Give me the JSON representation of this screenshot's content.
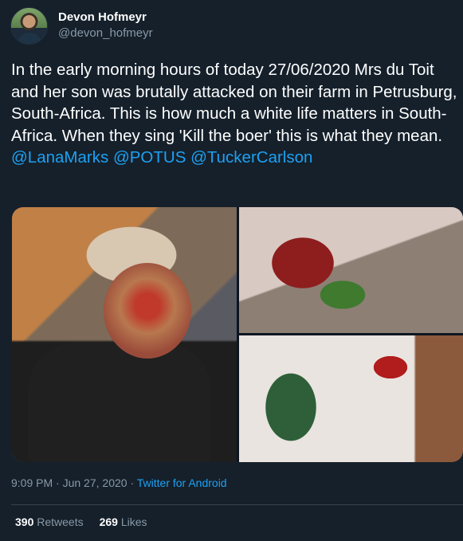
{
  "author": {
    "display_name": "Devon Hofmeyr",
    "handle": "@devon_hofmeyr"
  },
  "tweet": {
    "text_before": "In the early morning hours of today 27/06/2020 Mrs du Toit and her son was brutally attacked on their farm in Petrusburg, South-Africa. This is how much a white life matters in South-Africa. When they sing 'Kill the boer' this is what they mean. ",
    "mentions": [
      "@LanaMarks",
      "@POTUS",
      "@TuckerCarlson"
    ]
  },
  "meta": {
    "time": "9:09 PM",
    "separator": " · ",
    "date": "Jun 27, 2020",
    "source": "Twitter for Android"
  },
  "stats": {
    "retweets_count": "390",
    "retweets_label": "Retweets",
    "likes_count": "269",
    "likes_label": "Likes"
  },
  "colors": {
    "background": "#15202b",
    "text": "#ffffff",
    "secondary": "#8899a6",
    "accent": "#1da1f2"
  }
}
